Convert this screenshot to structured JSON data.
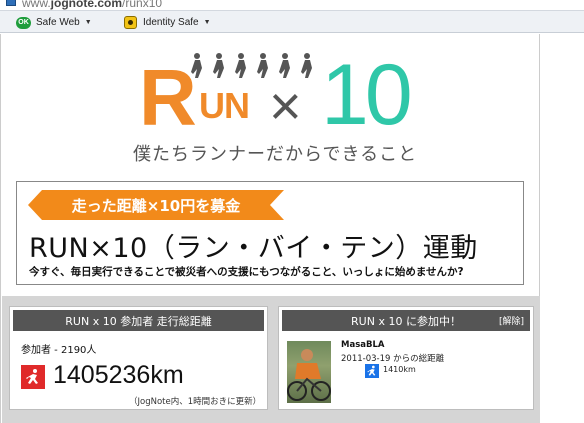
{
  "browser": {
    "url_prefix": "www.",
    "url_domain": "jognote.com",
    "url_path": "/runx10"
  },
  "toolbar": {
    "safe_web_icon_text": "OK",
    "safe_web": "Safe Web",
    "identity_safe": "Identity Safe",
    "caret": "▼"
  },
  "logo": {
    "r": "R",
    "un": "UN",
    "x": "×",
    "ten": "10",
    "tagline": "僕たちランナーだからできること"
  },
  "banner": {
    "ribbon": "走った距離×10円を募金",
    "title": "RUN×10（ラン・バイ・テン）運動",
    "subtitle": "今すぐ、毎日実行できることで被災者への支援にもつながること、いっしょに始めませんか?",
    "ribbon_color": "#f28a1a"
  },
  "stats": {
    "total_panel": {
      "header": "RUN x 10 参加者 走行総距離",
      "participants": "参加者 - 2190人",
      "total_km": "1405236km",
      "note": "（JogNote内、1時間おきに更新）"
    },
    "user_panel": {
      "header": "RUN x 10 に参加中！",
      "unjoin": "[解除]",
      "user_name": "MasaBLA",
      "since": "2011-03-19 からの総距離",
      "km": "1410km"
    }
  },
  "colors": {
    "accent_orange": "#f08a2a",
    "accent_teal": "#2fc7a8",
    "runner_icon_red": "#e02a2a",
    "runner_icon_blue": "#1a73e8"
  }
}
